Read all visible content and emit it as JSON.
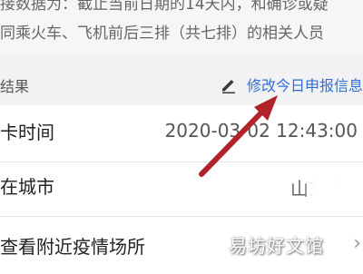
{
  "notice": {
    "line1": "接数据为：截止当前日期的14天内，和确诊或疑",
    "line2": "同乘火车、飞机前后三排（共七排）的相关人员"
  },
  "result_header": {
    "title": "结果",
    "edit_link": "修改今日申报信息",
    "edit_icon": "pencil-icon"
  },
  "rows": [
    {
      "label": "卡时间",
      "value": "2020-03-02 12:43:00"
    },
    {
      "label": "在城市",
      "value": "山东省"
    },
    {
      "label": "查看附近疫情场所",
      "icon": "chevron-right-icon"
    }
  ],
  "annotation": {
    "color": "#b2222a"
  },
  "watermark": "易坊好文馆",
  "colors": {
    "link": "#2f6fd6",
    "background": "#f2f2f4",
    "arrow": "#b2222a"
  }
}
